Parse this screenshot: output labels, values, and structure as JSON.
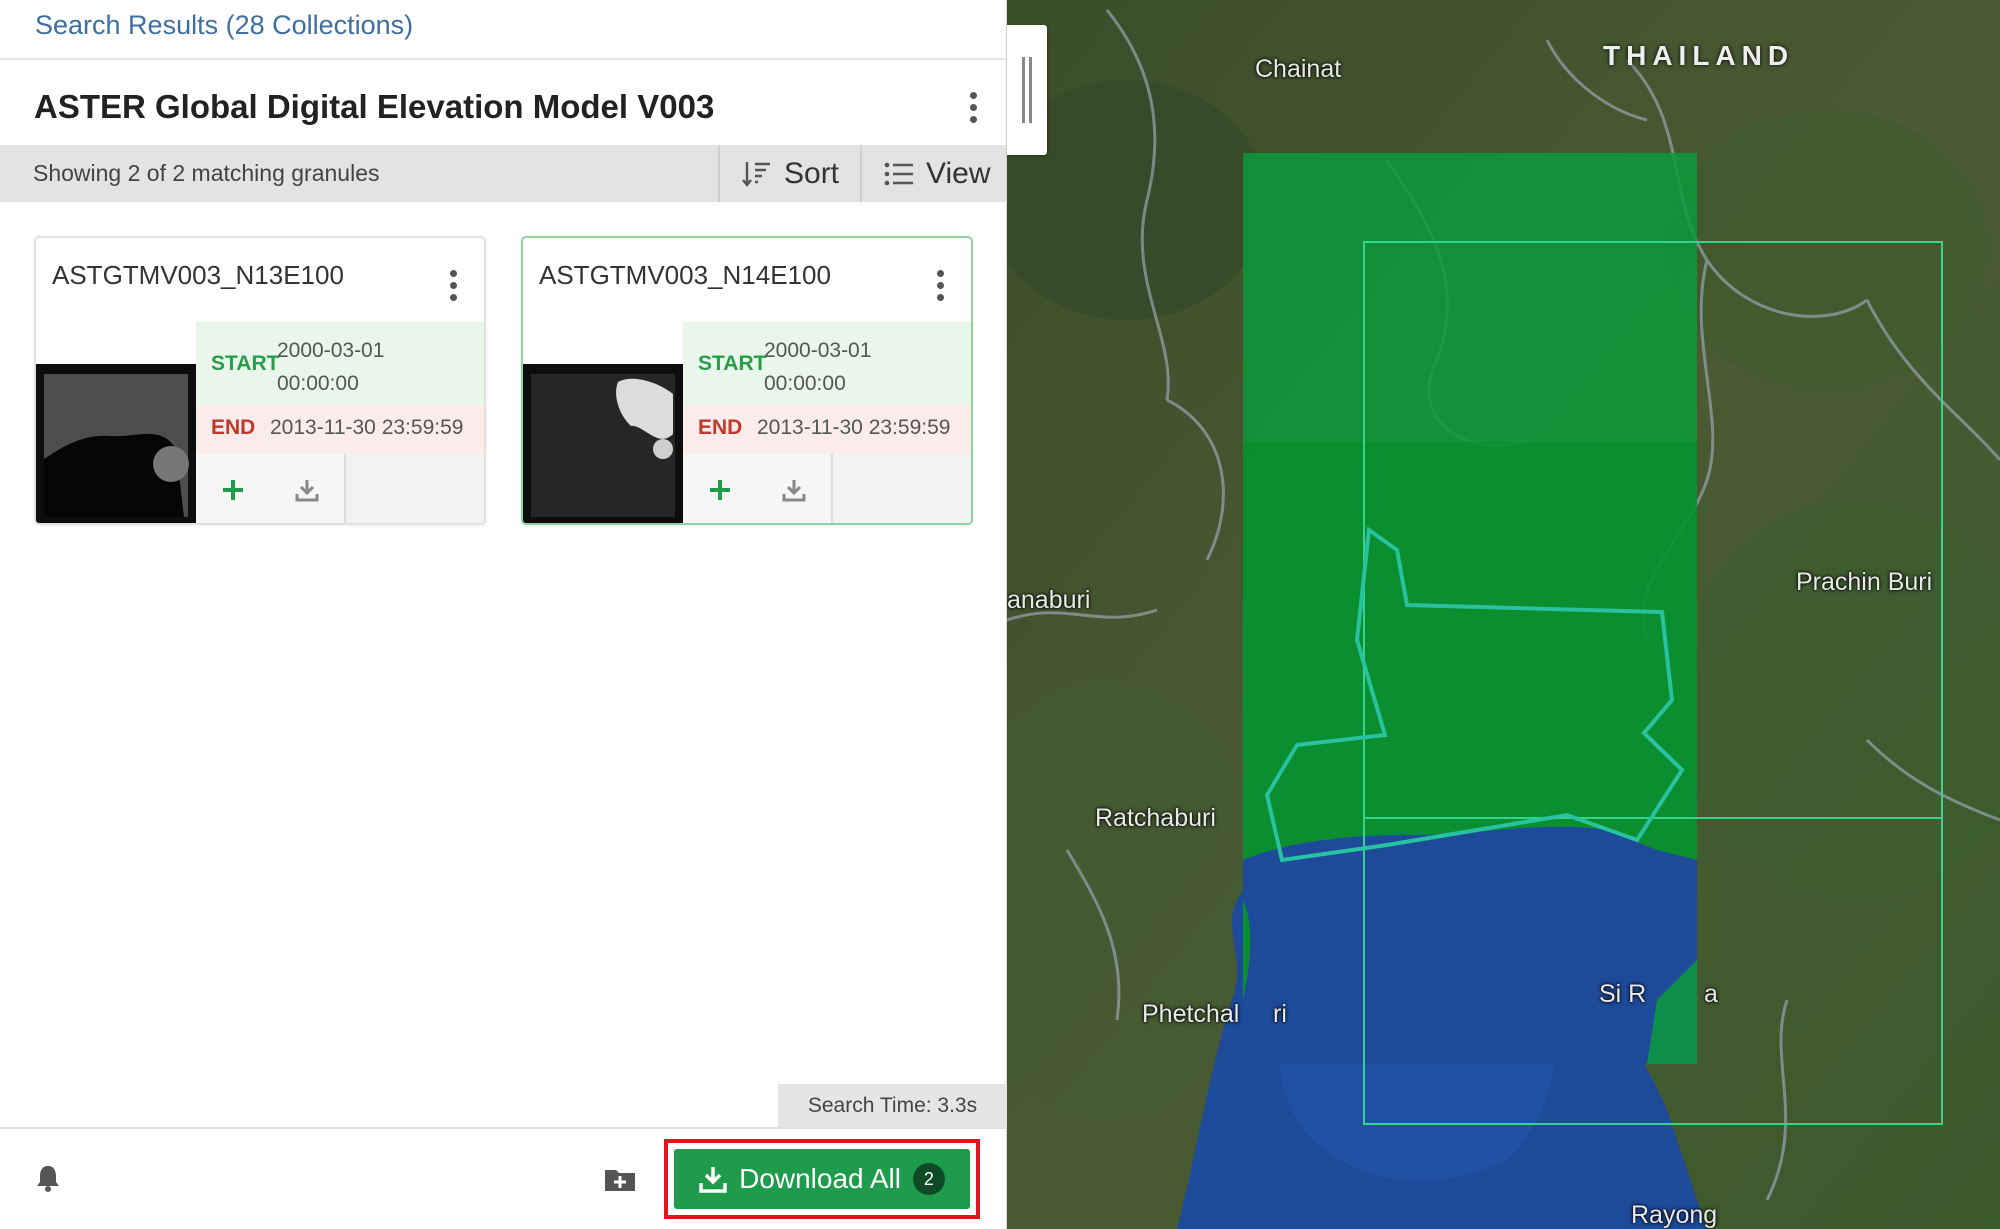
{
  "results_header": {
    "title": "Search Results (28 Collections)"
  },
  "collection": {
    "title": "ASTER Global Digital Elevation Model V003"
  },
  "toolbar": {
    "showing": "Showing 2 of 2 matching granules",
    "sort_label": "Sort",
    "view_label": "View"
  },
  "granules": [
    {
      "id": "ASTGTMV003_N13E100",
      "start_label": "START",
      "start_date": "2000-03-01",
      "start_time": "00:00:00",
      "end_label": "END",
      "end_value": "2013-11-30 23:59:59"
    },
    {
      "id": "ASTGTMV003_N14E100",
      "start_label": "START",
      "start_date": "2000-03-01",
      "start_time": "00:00:00",
      "end_label": "END",
      "end_value": "2013-11-30 23:59:59"
    }
  ],
  "search_time": "Search Time: 3.3s",
  "footer": {
    "download_label": "Download All",
    "download_count": "2"
  },
  "map": {
    "country": "THAILAND",
    "places": [
      "Chainat",
      "anaburi",
      "Prachin Buri",
      "Ratchaburi",
      "Phetchal",
      "ri",
      "Si R",
      "a",
      "Rayong"
    ]
  },
  "colors": {
    "accent": "#1f9c4b",
    "link": "#3f6fa0",
    "highlight": "#e0161b",
    "start": "#2a9d4a",
    "end": "#c0392b"
  },
  "icons": [
    "kebab-icon",
    "sort-icon",
    "list-view-icon",
    "plus-icon",
    "download-icon",
    "bell-icon",
    "folder-plus-icon"
  ]
}
